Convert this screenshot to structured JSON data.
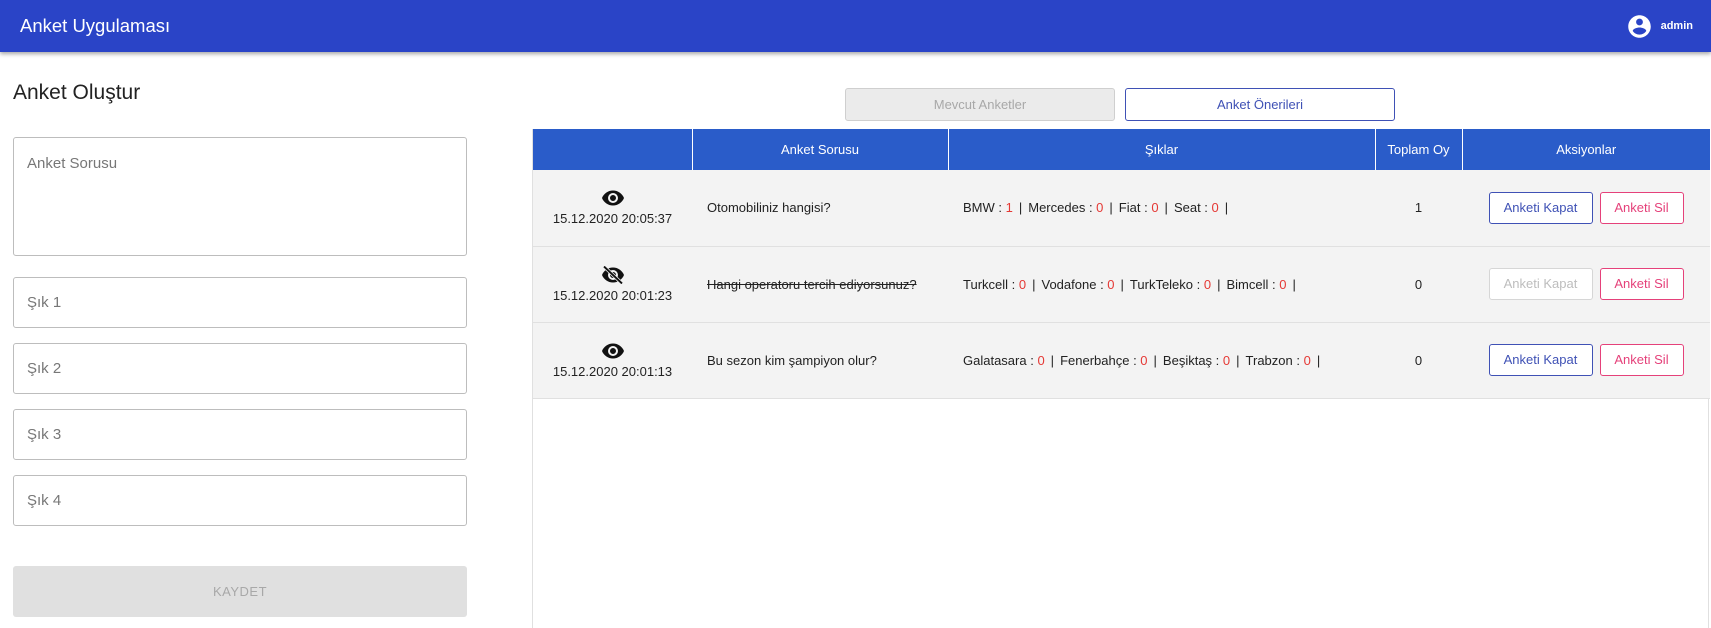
{
  "header": {
    "title": "Anket Uygulaması",
    "user": "admin"
  },
  "form": {
    "heading": "Anket Oluştur",
    "question_placeholder": "Anket Sorusu",
    "options": [
      "Şık 1",
      "Şık 2",
      "Şık 3",
      "Şık 4"
    ],
    "save_label": "KAYDET"
  },
  "tabs": [
    {
      "label": "Mevcut Anketler",
      "state": "disabled"
    },
    {
      "label": "Anket Önerileri",
      "state": "active"
    }
  ],
  "table": {
    "headers": [
      "",
      "Anket Sorusu",
      "Şıklar",
      "Toplam Oy",
      "Aksiyonlar"
    ],
    "rows": [
      {
        "date": "15.12.2020 20:05:37",
        "icon": "eye-icon",
        "closed": false,
        "question": "Otomobiliniz hangisi?",
        "options": [
          {
            "name": "BMW",
            "votes": "1"
          },
          {
            "name": "Mercedes",
            "votes": "0"
          },
          {
            "name": "Fiat",
            "votes": "0"
          },
          {
            "name": "Seat",
            "votes": "0"
          }
        ],
        "total": "1",
        "close_label": "Anketi Kapat",
        "delete_label": "Anketi Sil"
      },
      {
        "date": "15.12.2020 20:01:23",
        "icon": "eye-off-icon",
        "closed": true,
        "question": "Hangi operatoru tercih ediyorsunuz?",
        "options": [
          {
            "name": "Turkcell",
            "votes": "0"
          },
          {
            "name": "Vodafone",
            "votes": "0"
          },
          {
            "name": "TurkTeleko",
            "votes": "0"
          },
          {
            "name": "Bimcell",
            "votes": "0"
          }
        ],
        "total": "0",
        "close_label": "Anketi Kapat",
        "delete_label": "Anketi Sil"
      },
      {
        "date": "15.12.2020 20:01:13",
        "icon": "eye-icon",
        "closed": false,
        "question": "Bu sezon kim şampiyon olur?",
        "options": [
          {
            "name": "Galatasara",
            "votes": "0"
          },
          {
            "name": "Fenerbahçe",
            "votes": "0"
          },
          {
            "name": "Beşiktaş",
            "votes": "0"
          },
          {
            "name": "Trabzon",
            "votes": "0"
          }
        ],
        "total": "0",
        "close_label": "Anketi Kapat",
        "delete_label": "Anketi Sil"
      }
    ]
  },
  "colors": {
    "appbar": "#2a44c7",
    "table_header": "#2a5cc9",
    "primary": "#3f51b5",
    "danger": "#e5417a",
    "vote": "#e53935"
  }
}
